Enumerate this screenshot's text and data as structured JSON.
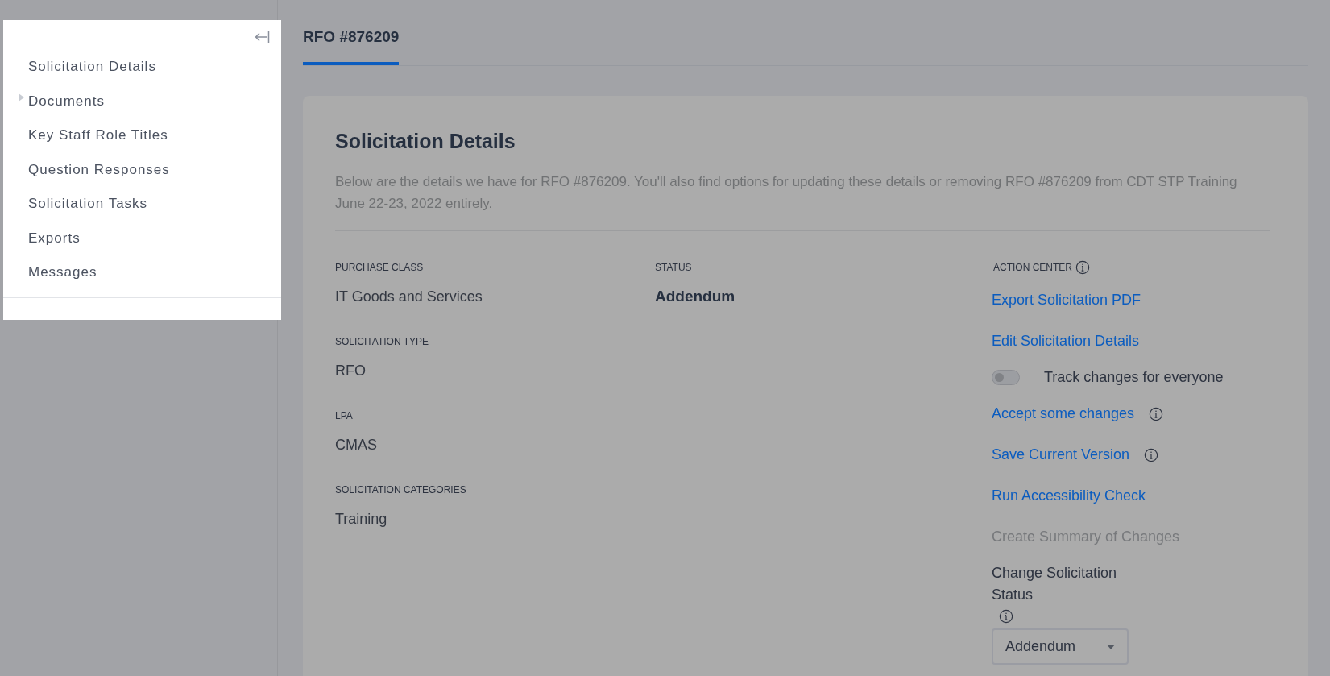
{
  "sidebar": {
    "items": [
      {
        "label": "Solicitation Details",
        "has_children": false
      },
      {
        "label": "Documents",
        "has_children": true
      },
      {
        "label": "Key Staff Role Titles",
        "has_children": false
      },
      {
        "label": "Question Responses",
        "has_children": false
      },
      {
        "label": "Solicitation Tasks",
        "has_children": false
      },
      {
        "label": "Exports",
        "has_children": false
      },
      {
        "label": "Messages",
        "has_children": false
      }
    ]
  },
  "tabs": [
    {
      "label": "RFO #876209",
      "selected": true
    }
  ],
  "card": {
    "title": "Solicitation Details",
    "description": "Below are the details we have for RFO #876209. You'll also find options for updating these details or removing RFO #876209 from CDT STP Training June 22-23, 2022 entirely.",
    "fields": [
      {
        "label": "PURCHASE CLASS",
        "value": "IT Goods and Services"
      },
      {
        "label": "SOLICITATION TYPE",
        "value": "RFO"
      },
      {
        "label": "LPA",
        "value": "CMAS"
      },
      {
        "label": "SOLICITATION CATEGORIES",
        "value": "Training"
      }
    ],
    "status": {
      "label": "STATUS",
      "value": "Addendum"
    },
    "action_center": {
      "title": "ACTION CENTER",
      "items": [
        {
          "kind": "link",
          "label": "Export Solicitation PDF",
          "info": false
        },
        {
          "kind": "link",
          "label": "Edit Solicitation Details",
          "info": false
        },
        {
          "kind": "toggle",
          "label": "Track changes for everyone",
          "on": false
        },
        {
          "kind": "link",
          "label": "Accept some changes",
          "info": true
        },
        {
          "kind": "link",
          "label": "Save Current Version",
          "info": true
        },
        {
          "kind": "link",
          "label": "Run Accessibility Check",
          "info": false
        },
        {
          "kind": "disabled",
          "label": "Create Summary of Changes"
        },
        {
          "kind": "select",
          "label": "Change Solicitation Status",
          "value": "Addendum"
        }
      ]
    }
  }
}
